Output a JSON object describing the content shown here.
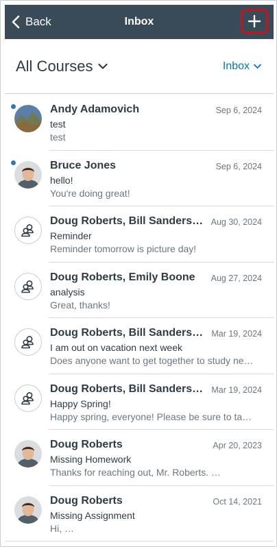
{
  "nav": {
    "back_label": "Back",
    "title": "Inbox",
    "compose_icon": "plus-icon"
  },
  "filters": {
    "course": "All Courses",
    "scope": "Inbox"
  },
  "colors": {
    "navbar": "#394b58",
    "accent": "#0374b5",
    "unread": "#2b7abc",
    "highlight": "#c3161c"
  },
  "conversations": [
    {
      "names": "Andy Adamovich",
      "date": "Sep 6, 2024",
      "subject": "test",
      "preview": "test",
      "unread": true,
      "avatar": "photo-landscape"
    },
    {
      "names": "Bruce Jones",
      "date": "Sep 6, 2024",
      "subject": "hello!",
      "preview": "You're doing great!",
      "unread": true,
      "avatar": "photo-person"
    },
    {
      "names": "Doug Roberts, Bill Sanderson...",
      "date": "Aug 30, 2024",
      "subject": "Reminder",
      "preview": "Reminder tomorrow is picture day!",
      "unread": false,
      "avatar": "group-icon"
    },
    {
      "names": "Doug Roberts, Emily Boone",
      "date": "Aug 27, 2024",
      "subject": "analysis",
      "preview": "Great, thanks!",
      "unread": false,
      "avatar": "group-icon"
    },
    {
      "names": "Doug Roberts, Bill Sanderson...",
      "date": "Mar 19, 2024",
      "subject": "I am out on vacation next week",
      "preview": "Does anyone want to get together to study next…",
      "unread": false,
      "avatar": "group-icon"
    },
    {
      "names": "Doug Roberts, Bill Sanderson...",
      "date": "Mar 19, 2024",
      "subject": "Happy Spring!",
      "preview": "Happy spring, everyone! Please be sure to take th…",
      "unread": false,
      "avatar": "group-icon"
    },
    {
      "names": "Doug Roberts",
      "date": "Apr 20, 2023",
      "subject": "Missing Homework",
      "preview": "Thanks for reaching out, Mr. Roberts. …",
      "unread": false,
      "avatar": "photo-person"
    },
    {
      "names": "Doug Roberts",
      "date": "Oct 14, 2021",
      "subject": "Missing Assignment",
      "preview": "Hi, …",
      "unread": false,
      "avatar": "photo-person"
    }
  ]
}
